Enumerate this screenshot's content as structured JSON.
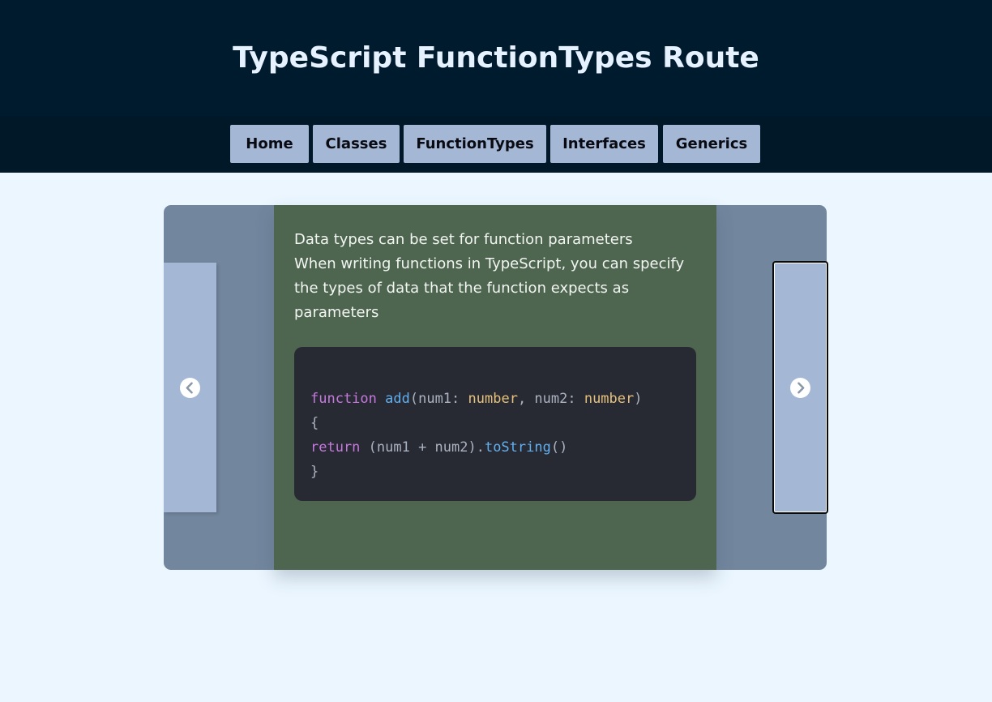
{
  "header": {
    "title": "TypeScript FunctionTypes Route"
  },
  "nav": {
    "items": [
      {
        "label": "Home"
      },
      {
        "label": "Classes"
      },
      {
        "label": "FunctionTypes"
      },
      {
        "label": "Interfaces"
      },
      {
        "label": "Generics"
      }
    ]
  },
  "slide": {
    "heading": "Data types can be set for function parameters",
    "body_lines": [
      "When writing functions in TypeScript, you can specify",
      "the types of data that the function expects as",
      "parameters"
    ],
    "code": {
      "line1": {
        "kw": "function",
        "sp1": " ",
        "name": "add",
        "open": "(num1: ",
        "type1": "number",
        "mid": ", num2: ",
        "type2": "number",
        "close": ")"
      },
      "line2": "{",
      "line3": {
        "kw": "return",
        "expr": " (num1 + num2).",
        "method": "toString",
        "call": "()"
      },
      "line4": "}"
    }
  },
  "controls": {
    "prev_icon": "chevron-left-circle-icon",
    "next_icon": "chevron-right-circle-icon"
  },
  "colors": {
    "header_bg": "#001a2e",
    "nav_button_bg": "#a4b8d6",
    "page_bg": "#ebf6ff",
    "carousel_bg": "#72869e",
    "slide_bg": "#4e6650",
    "code_bg": "#272a33"
  }
}
